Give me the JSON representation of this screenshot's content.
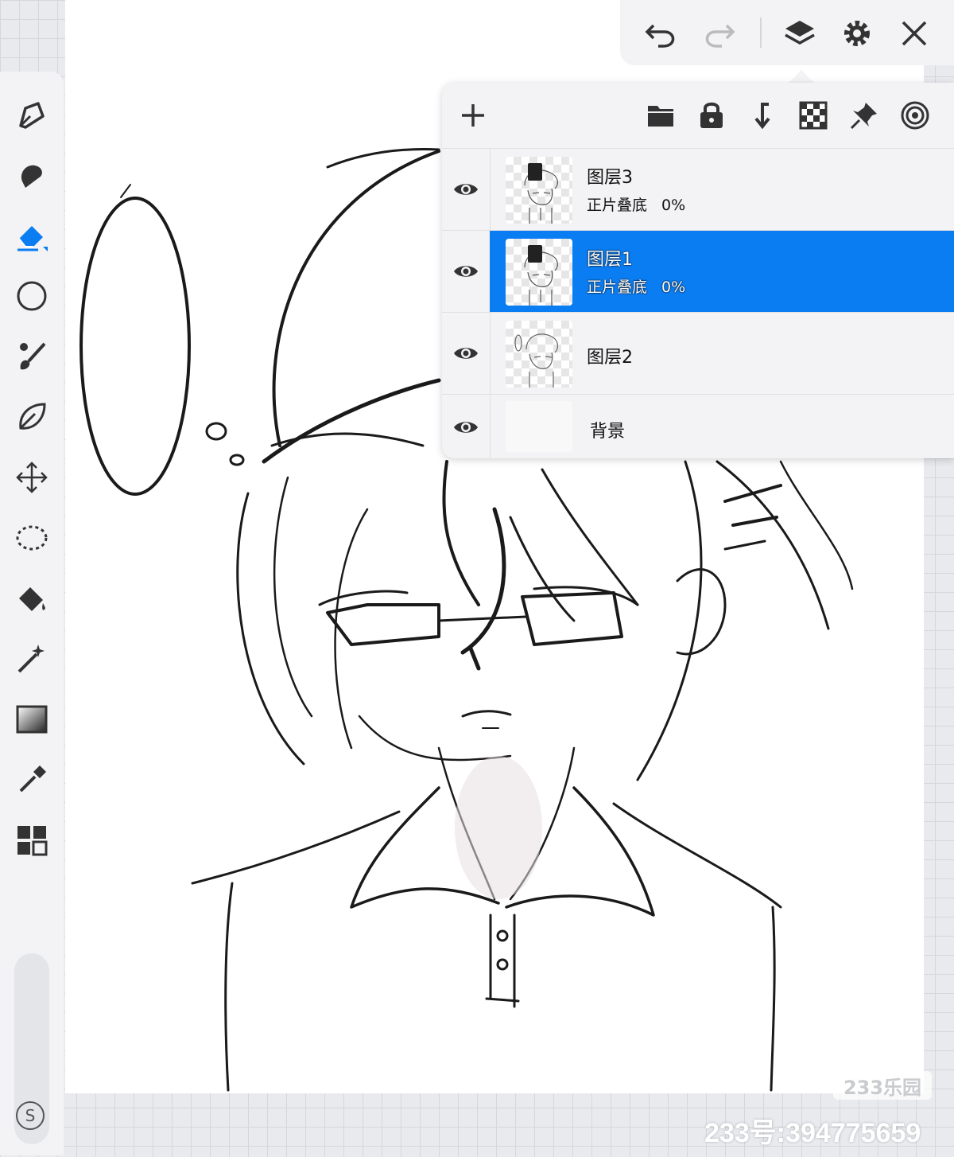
{
  "toolbar": {
    "tools": [
      "pen-icon",
      "smudge-icon",
      "eraser-icon",
      "shape-icon",
      "brush-icon",
      "leaf-icon",
      "move-icon",
      "lasso-icon",
      "fill-bucket-icon",
      "magic-wand-icon",
      "gradient-icon",
      "eyedropper-icon",
      "grid-icon"
    ],
    "active_tool": "eraser-icon",
    "s_button": "S"
  },
  "topbar": {
    "icons": [
      "undo-icon",
      "redo-icon",
      "layers-icon",
      "settings-icon",
      "close-icon"
    ]
  },
  "layers_panel": {
    "actions": [
      "add-layer-icon",
      "folder-icon",
      "lock-icon",
      "merge-down-icon",
      "alpha-lock-icon",
      "pin-icon",
      "target-icon"
    ],
    "layers": [
      {
        "name": "图层3",
        "blend_mode": "正片叠底",
        "opacity": "0%",
        "visible": true,
        "selected": false
      },
      {
        "name": "图层1",
        "blend_mode": "正片叠底",
        "opacity": "0%",
        "visible": true,
        "selected": true
      },
      {
        "name": "图层2",
        "visible": true,
        "selected": false
      },
      {
        "name": "背景",
        "visible": true,
        "selected": false
      }
    ]
  },
  "colors": {
    "accent": "#0a7df2",
    "panel_bg": "#f3f3f5",
    "icon": "#333333"
  },
  "watermark": {
    "logo": "233乐园",
    "id_text": "233号:394775659"
  }
}
